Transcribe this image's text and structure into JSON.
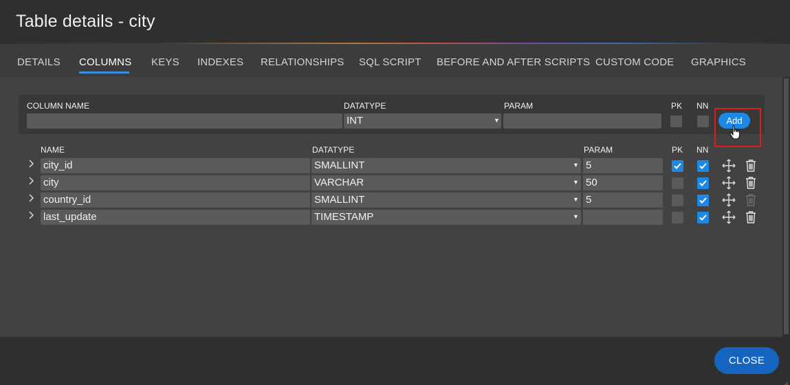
{
  "window": {
    "title": "Table details - city"
  },
  "tabs": [
    {
      "label": "DETAILS",
      "active": false
    },
    {
      "label": "COLUMNS",
      "active": true
    },
    {
      "label": "KEYS",
      "active": false
    },
    {
      "label": "INDEXES",
      "active": false
    },
    {
      "label": "RELATIONSHIPS",
      "active": false
    },
    {
      "label": "SQL SCRIPT",
      "active": false
    },
    {
      "label": "BEFORE AND AFTER SCRIPTS",
      "active": false
    },
    {
      "label": "CUSTOM CODE",
      "active": false
    },
    {
      "label": "GRAPHICS",
      "active": false
    }
  ],
  "new_column": {
    "headers": {
      "name": "COLUMN NAME",
      "datatype": "DATATYPE",
      "param": "PARAM",
      "pk": "PK",
      "nn": "NN"
    },
    "name_value": "",
    "datatype_value": "INT",
    "param_value": "",
    "pk": false,
    "nn": false,
    "add_label": "Add"
  },
  "columns_table": {
    "headers": {
      "name": "NAME",
      "datatype": "DATATYPE",
      "param": "PARAM",
      "pk": "PK",
      "nn": "NN"
    },
    "rows": [
      {
        "name": "city_id",
        "datatype": "SMALLINT",
        "param": "5",
        "pk": true,
        "nn": true,
        "delete_enabled": true
      },
      {
        "name": "city",
        "datatype": "VARCHAR",
        "param": "50",
        "pk": false,
        "nn": true,
        "delete_enabled": true
      },
      {
        "name": "country_id",
        "datatype": "SMALLINT",
        "param": "5",
        "pk": false,
        "nn": true,
        "delete_enabled": false
      },
      {
        "name": "last_update",
        "datatype": "TIMESTAMP",
        "param": "",
        "pk": false,
        "nn": true,
        "delete_enabled": true
      }
    ]
  },
  "footer": {
    "close_label": "CLOSE"
  },
  "colors": {
    "accent": "#1e88e5",
    "close_button": "#1565c0",
    "highlight": "#e01b1b"
  },
  "icons": {
    "expand": "chevron-right-icon",
    "move": "move-arrows-icon",
    "delete": "trash-icon",
    "check": "check-icon",
    "cursor": "hand-pointer-icon"
  }
}
